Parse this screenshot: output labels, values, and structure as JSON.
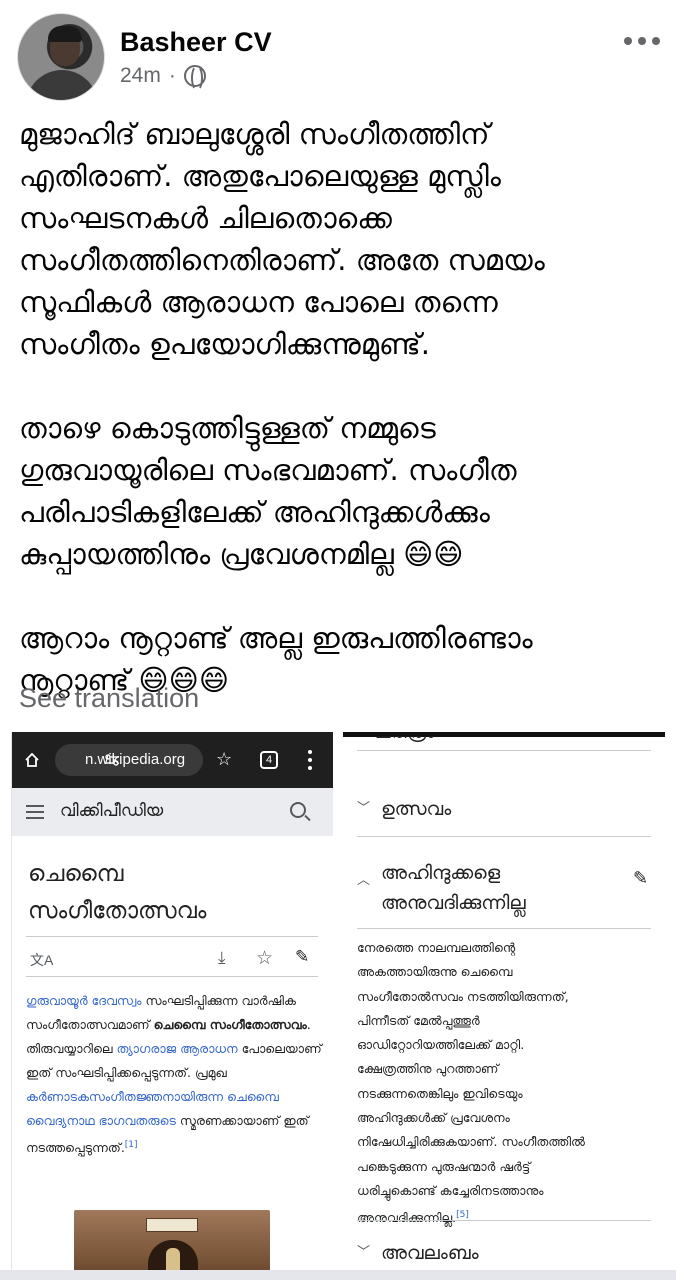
{
  "post": {
    "author": "Basheer CV",
    "time": "24m",
    "separator": "·",
    "privacy_icon": "globe-icon",
    "more_icon": "more-horizontal-icon",
    "paragraphs": [
      "മുജാഹിദ് ബാലുശ്ശേരി സംഗീതത്തിന്\nഎതിരാണ്.  അതുപോലെയുള്ള മുസ്ലിം\nസംഘടനകൾ ചിലതൊക്കെ\nസംഗീതത്തിനെതിരാണ്.  അതേ സമയം\nസൂഫികൾ ആരാധന പോലെ തന്നെ\nസംഗീതം ഉപയോഗിക്കുന്നുമുണ്ട്.",
      "താഴെ കൊടുത്തിട്ടുള്ളത് നമ്മുടെ\nഗുരുവായൂരിലെ സംഭവമാണ്. സംഗീത\nപരിപാടികളിലേക്ക് അഹിന്ദുക്കൾക്കും\nകുപ്പായത്തിനും  പ്രവേശനമില്ല 😄😄",
      "ആറാം നൂറ്റാണ്ട് അല്ല ഇരുപത്തിരണ്ടാം\nനൂറ്റാണ്ട് 😄😄😄"
    ],
    "see_translation": "See translation"
  },
  "left_screenshot": {
    "browser": {
      "url": "n.wikipedia.org",
      "tab_count": "4",
      "icons": [
        "home-icon",
        "tune-icon",
        "star-outline-icon",
        "tabs-icon",
        "kebab-menu-icon"
      ]
    },
    "wiki_header": {
      "brand": "വിക്കിപീഡിയ",
      "icons": [
        "hamburger-icon",
        "search-icon"
      ]
    },
    "title": "ചെമ്പൈ\nസംഗീതോത്സവം",
    "page_actions": {
      "translate": "文A",
      "icons": [
        "translate-icon",
        "download-icon",
        "star-icon",
        "edit-icon"
      ]
    },
    "body": {
      "link1": "ഗുരുവായൂർ ദേവസ്വം",
      "text1": " സംഘടിപ്പിക്കുന്ന വാർഷിക സംഗീതോത്സവമാണ് ",
      "bold1": "ചെമ്പൈ സംഗീതോത്സവം",
      "text2": ". തിരുവയ്യാറിലെ ",
      "link2": "ത്യാഗരാജ ആരാധന",
      "text3": " പോലെയാണ് ഇത് സംഘടിപ്പിക്കപ്പെടുന്നത്. പ്രമുഖ ",
      "link3": "കർണാടകസംഗീതജ്ഞനായിരുന്ന ചെമ്പൈ വൈദ്യനാഥ ഭാഗവതരുടെ",
      "text4": " സ്മരണക്കായാണ് ഇത് നടത്തപ്പെടുന്നത്.",
      "ref": "[1]"
    },
    "image_alt": "temple-photo"
  },
  "right_screenshot": {
    "sections": [
      {
        "label": "ഉത്സവം",
        "expanded": false
      },
      {
        "label": "അഹിന്ദുക്കളെ\nഅനുവദിക്കുന്നില്ല",
        "expanded": true
      },
      {
        "label": "അവലംബം",
        "expanded": false
      }
    ],
    "chevron_down": "﹀",
    "chevron_up": "︿",
    "body": "നേരത്തെ നാലമ്പലത്തിന്റെ\nഅകത്തായിരുന്നു ചെമ്പൈ\nസംഗീതോൽസവം നടത്തിയിരുന്നത്,\nപിന്നീടത് മേൽപ്പത്തൂർ\nഓഡിറ്റോറിയത്തിലേക്ക് മാറ്റി.\nക്ഷേത്രത്തിനു പുറത്താണ്\nനടക്കുന്നതെങ്കിലും ഇവിടെയും\nഅഹിന്ദുക്കൾക്ക് പ്രവേശനം\nനിഷേധിച്ചിരിക്കുകയാണ്. സംഗീതത്തിൽ\nപങ്കെടുക്കുന്ന പുരുഷന്മാർ ഷർട്ട്\nധരിച്ചുകൊണ്ട് കച്ചേരിനടത്താനും\nഅനുവദിക്കുന്നില്ല.",
    "ref": "[5]"
  }
}
